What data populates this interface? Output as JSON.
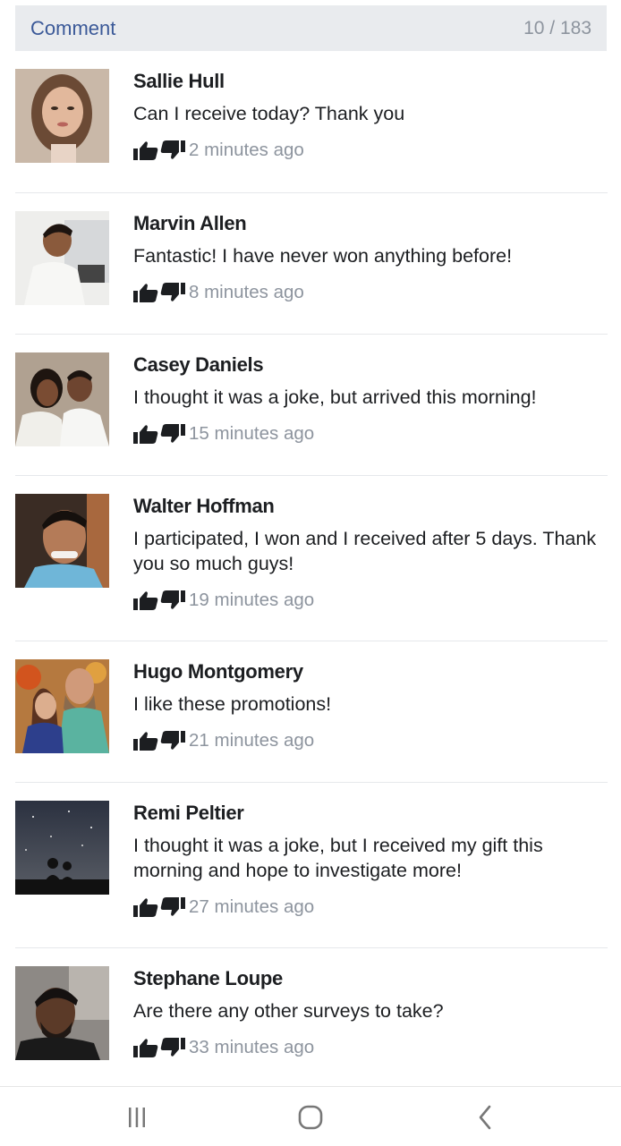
{
  "header": {
    "title": "Comment",
    "count": "10 / 183"
  },
  "comments": [
    {
      "name": "Sallie Hull",
      "text": "Can I receive today? Thank you",
      "time": "2 minutes ago"
    },
    {
      "name": "Marvin Allen",
      "text": "Fantastic! I have never won anything before!",
      "time": "8 minutes ago"
    },
    {
      "name": "Casey Daniels",
      "text": "I thought it was a joke, but arrived this morning!",
      "time": "15 minutes ago"
    },
    {
      "name": "Walter Hoffman",
      "text": "I participated, I won and I received after 5 days. Thank you so much guys!",
      "time": "19 minutes ago"
    },
    {
      "name": "Hugo Montgomery",
      "text": "I like these promotions!",
      "time": "21 minutes ago"
    },
    {
      "name": "Remi Peltier",
      "text": "I thought it was a joke, but I received my gift this morning and hope to investigate more!",
      "time": "27 minutes ago"
    },
    {
      "name": "Stephane Loupe",
      "text": "Are there any other surveys to take?",
      "time": "33 minutes ago"
    }
  ],
  "icons": {
    "like": "thumbs-up-icon",
    "dislike": "thumbs-down-icon",
    "nav_recents": "recent-apps-icon",
    "nav_home": "home-icon",
    "nav_back": "back-icon"
  },
  "colors": {
    "header_bg": "#e9ebee",
    "accent": "#3b5998",
    "muted": "#8d949e"
  }
}
